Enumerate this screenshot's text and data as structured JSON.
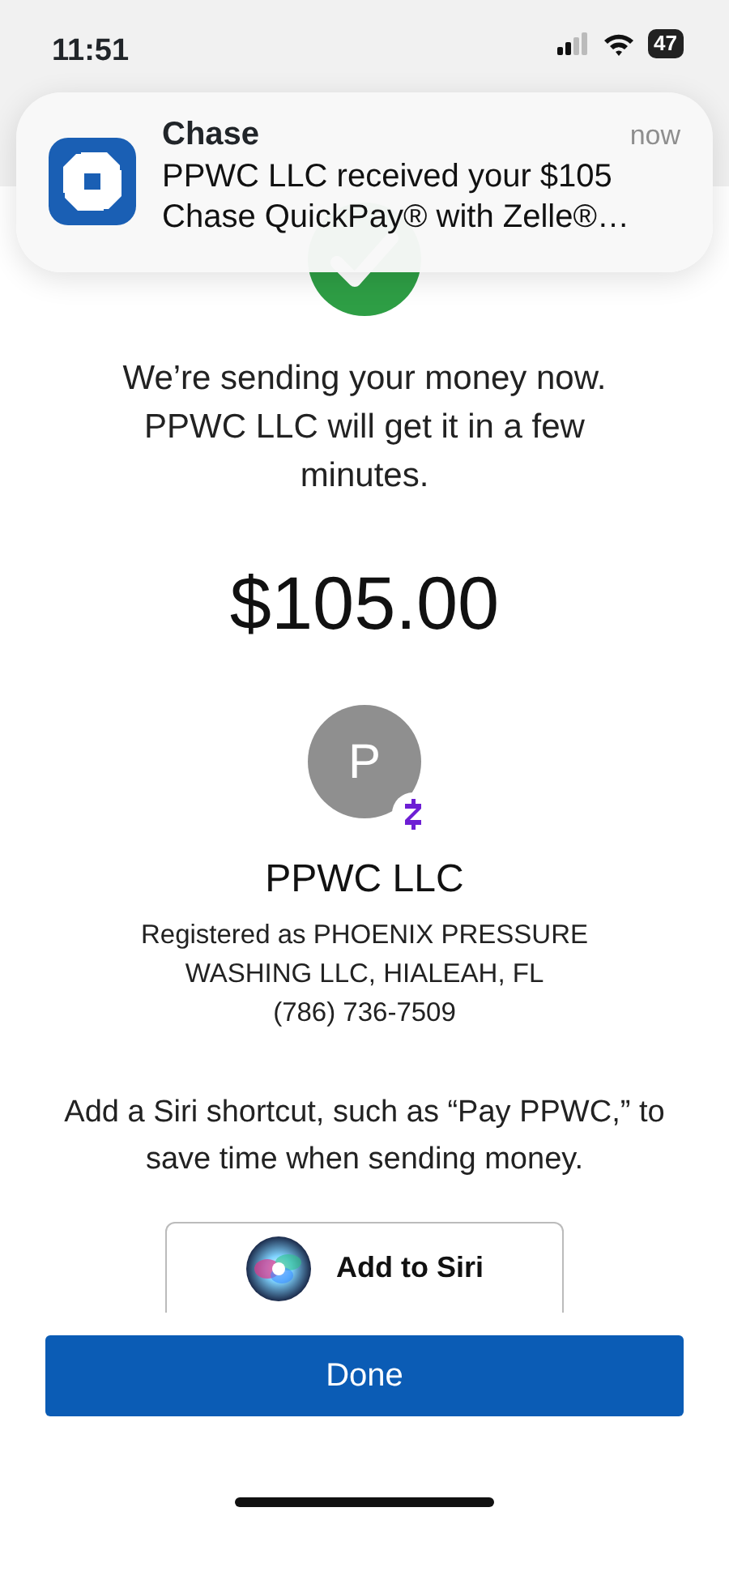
{
  "status_bar": {
    "time": "11:51",
    "battery": "47"
  },
  "notification": {
    "app": "Chase",
    "time": "now",
    "message": "PPWC LLC received your $105 Chase QuickPay® with Zelle®…"
  },
  "confirmation": {
    "message": "We’re sending your money now. PPWC LLC will get it in a few minutes.",
    "amount": "$105.00"
  },
  "recipient": {
    "initial": "P",
    "name": "PPWC LLC",
    "registration": "Registered as PHOENIX PRESSURE WASHING LLC, HIALEAH, FL",
    "phone": "(786) 736-7509"
  },
  "siri": {
    "prompt": "Add a Siri shortcut, such as “Pay PPWC,” to save time when sending money.",
    "button": "Add to Siri"
  },
  "done_button": "Done"
}
